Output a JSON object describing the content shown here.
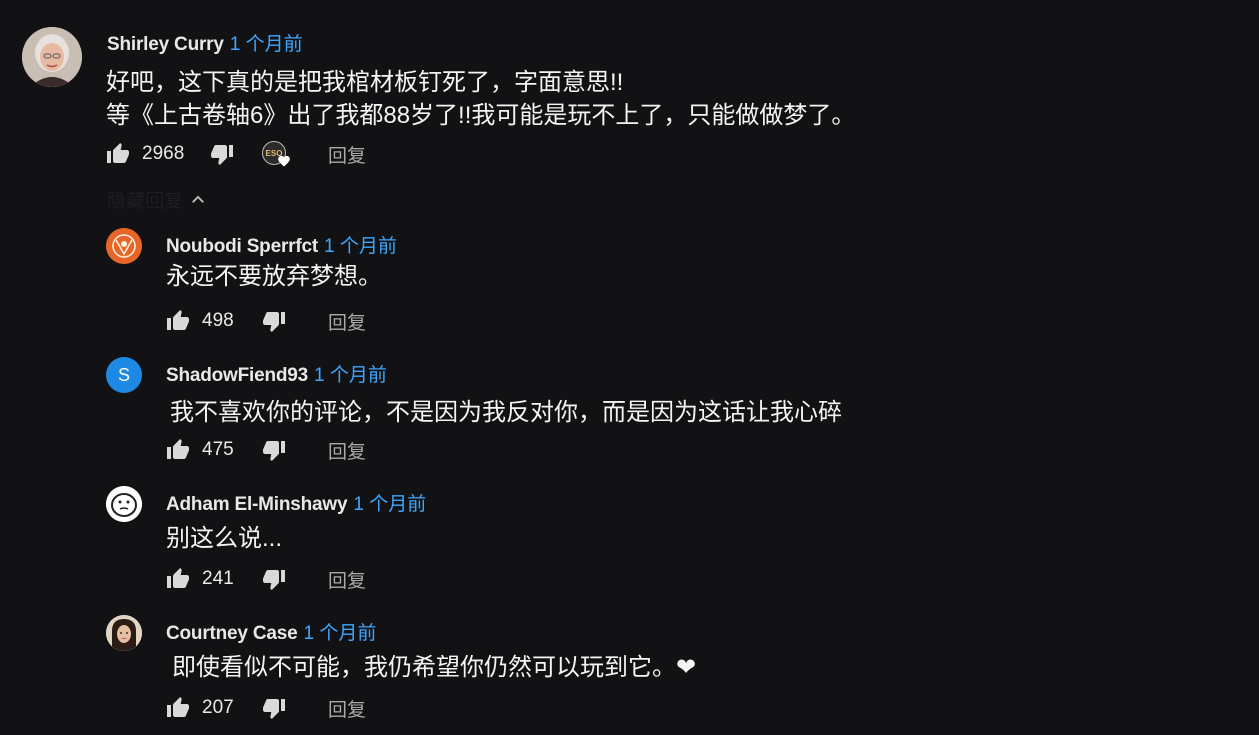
{
  "top_comment": {
    "author": "Shirley Curry",
    "time": "1 个月前",
    "lines": [
      "好吧，这下真的是把我棺材板钉死了，字面意思!!",
      "等《上古卷轴6》出了我都88岁了!!我可能是玩不上了，只能做做梦了。"
    ],
    "likes": "2968",
    "reply_label": "回复",
    "heart_badge_text": "ESO"
  },
  "hide_replies_label": "隐藏回复",
  "replies": [
    {
      "author": "Noubodi Sperrfct",
      "time": "1 个月前",
      "text": "永远不要放弃梦想。",
      "likes": "498",
      "reply_label": "回复"
    },
    {
      "author": "ShadowFiend93",
      "time": "1 个月前",
      "text": "我不喜欢你的评论，不是因为我反对你，而是因为这话让我心碎",
      "likes": "475",
      "reply_label": "回复",
      "avatar_letter": "S"
    },
    {
      "author": "Adham El-Minshawy",
      "time": "1 个月前",
      "text": "别这么说...",
      "likes": "241",
      "reply_label": "回复"
    },
    {
      "author": "Courtney Case",
      "time": "1 个月前",
      "text": "即使看似不可能，我仍希望你仍然可以玩到它。❤",
      "likes": "207",
      "reply_label": "回复"
    }
  ],
  "colors": {
    "background": "#121214",
    "link_blue": "#3ea6ff",
    "text": "#f1f1f1",
    "muted": "#aaaaaa",
    "orange_avatar": "#e8652a",
    "blue_avatar": "#1e88e5"
  }
}
